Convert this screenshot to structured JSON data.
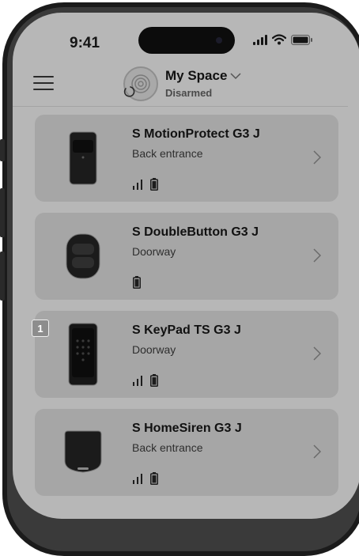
{
  "status_bar": {
    "time": "9:41"
  },
  "header": {
    "space_name": "My Space",
    "space_status": "Disarmed"
  },
  "devices": [
    {
      "name": "S MotionProtect G3 J",
      "room": "Back entrance",
      "icons": [
        "signal-icon",
        "battery-icon"
      ]
    },
    {
      "name": "S DoubleButton G3 J",
      "room": "Doorway",
      "icons": [
        "battery-icon"
      ]
    },
    {
      "name": "S KeyPad TS G3 J",
      "room": "Doorway",
      "icons": [
        "signal-icon",
        "battery-icon"
      ],
      "badge": "1"
    },
    {
      "name": "S HomeSiren G3 J",
      "room": "Back entrance",
      "icons": [
        "signal-icon",
        "battery-icon"
      ]
    }
  ],
  "colors": {
    "screen_bg": "#b7b7b7",
    "card_bg": "#a6a6a6",
    "phone_frame": "#1b1b1b",
    "text": "#111111"
  }
}
